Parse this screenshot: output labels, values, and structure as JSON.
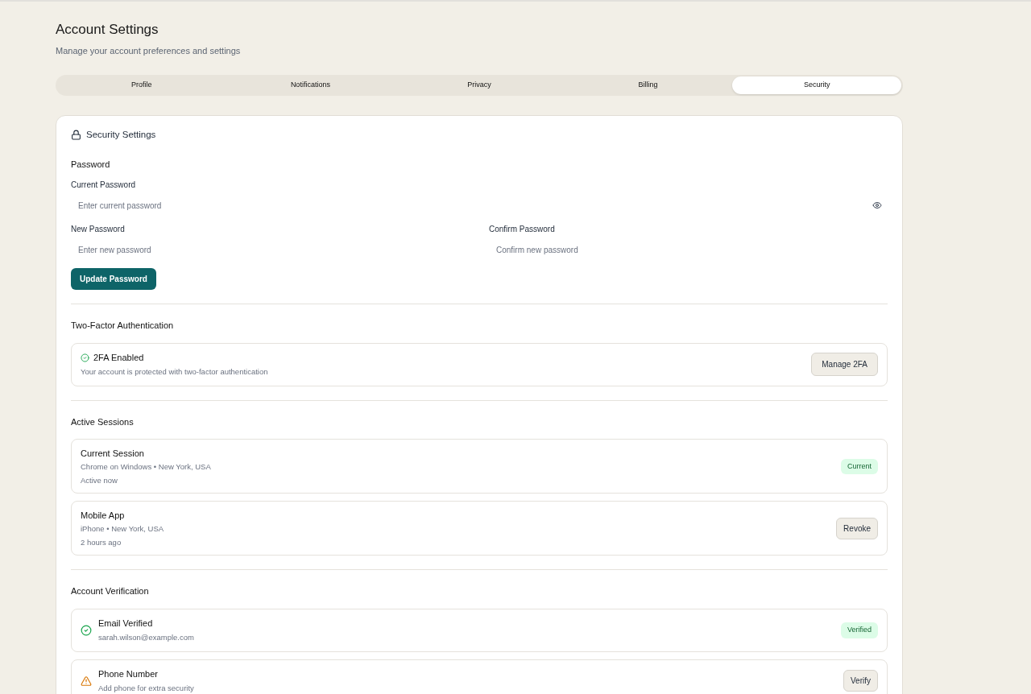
{
  "header": {
    "title": "Account Settings",
    "subtitle": "Manage your account preferences and settings"
  },
  "tabs": [
    {
      "label": "Profile",
      "selected": false
    },
    {
      "label": "Notifications",
      "selected": false
    },
    {
      "label": "Privacy",
      "selected": false
    },
    {
      "label": "Billing",
      "selected": false
    },
    {
      "label": "Security",
      "selected": true
    }
  ],
  "card": {
    "title": "Security Settings",
    "password": {
      "heading": "Password",
      "current": {
        "label": "Current Password",
        "placeholder": "Enter current password"
      },
      "new": {
        "label": "New Password",
        "placeholder": "Enter new password"
      },
      "confirm": {
        "label": "Confirm Password",
        "placeholder": "Confirm new password"
      },
      "button": "Update Password"
    },
    "two_factor": {
      "heading": "Two-Factor Authentication",
      "status": "2FA Enabled",
      "description": "Your account is protected with two-factor authentication",
      "button": "Manage 2FA"
    },
    "sessions": {
      "heading": "Active Sessions",
      "items": [
        {
          "name": "Current Session",
          "device": "Chrome on Windows • New York, USA",
          "time": "Active now",
          "action": {
            "kind": "badge",
            "label": "Current"
          }
        },
        {
          "name": "Mobile App",
          "device": "iPhone • New York, USA",
          "time": "2 hours ago",
          "action": {
            "kind": "button",
            "label": "Revoke"
          }
        }
      ]
    },
    "verification": {
      "heading": "Account Verification",
      "items": [
        {
          "kind": "check",
          "title": "Email Verified",
          "detail": "sarah.wilson@example.com",
          "action": {
            "kind": "badge",
            "label": "Verified"
          }
        },
        {
          "kind": "warning",
          "title": "Phone Number",
          "detail": "Add phone for extra security",
          "action": {
            "kind": "button",
            "label": "Verify"
          }
        }
      ]
    }
  }
}
